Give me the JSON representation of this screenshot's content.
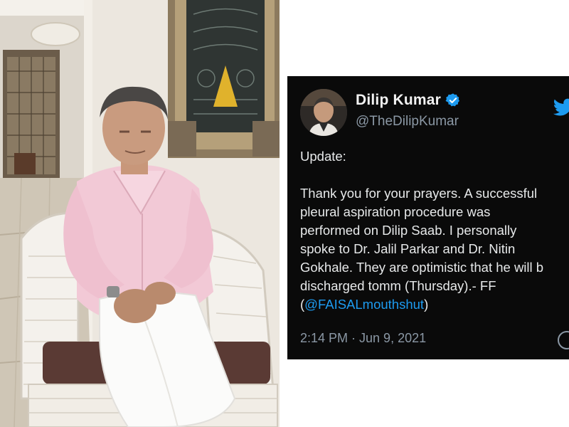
{
  "tweet": {
    "display_name": "Dilip Kumar",
    "handle": "@TheDilipKumar",
    "body_lines": [
      "Update:",
      "",
      "Thank you for your prayers. A successful",
      "pleural aspiration procedure was",
      "performed on Dilip Saab. I personally",
      "spoke to Dr. Jalil Parkar and Dr. Nitin",
      "Gokhale. They are optimistic that he will b",
      "discharged tomm (Thursday).- FF"
    ],
    "mention_prefix": "(",
    "mention": "@FAISALmouthshut",
    "mention_suffix": ")",
    "timestamp": "2:14 PM · Jun 9, 2021",
    "verified": true,
    "icons": {
      "verified": "verified-badge-icon",
      "brand": "twitter-bird-icon",
      "info": "info-icon"
    },
    "colors": {
      "background": "#0a0a0a",
      "text": "#e7e9ea",
      "secondary": "#8b98a5",
      "accent": "#1d9bf0"
    }
  }
}
